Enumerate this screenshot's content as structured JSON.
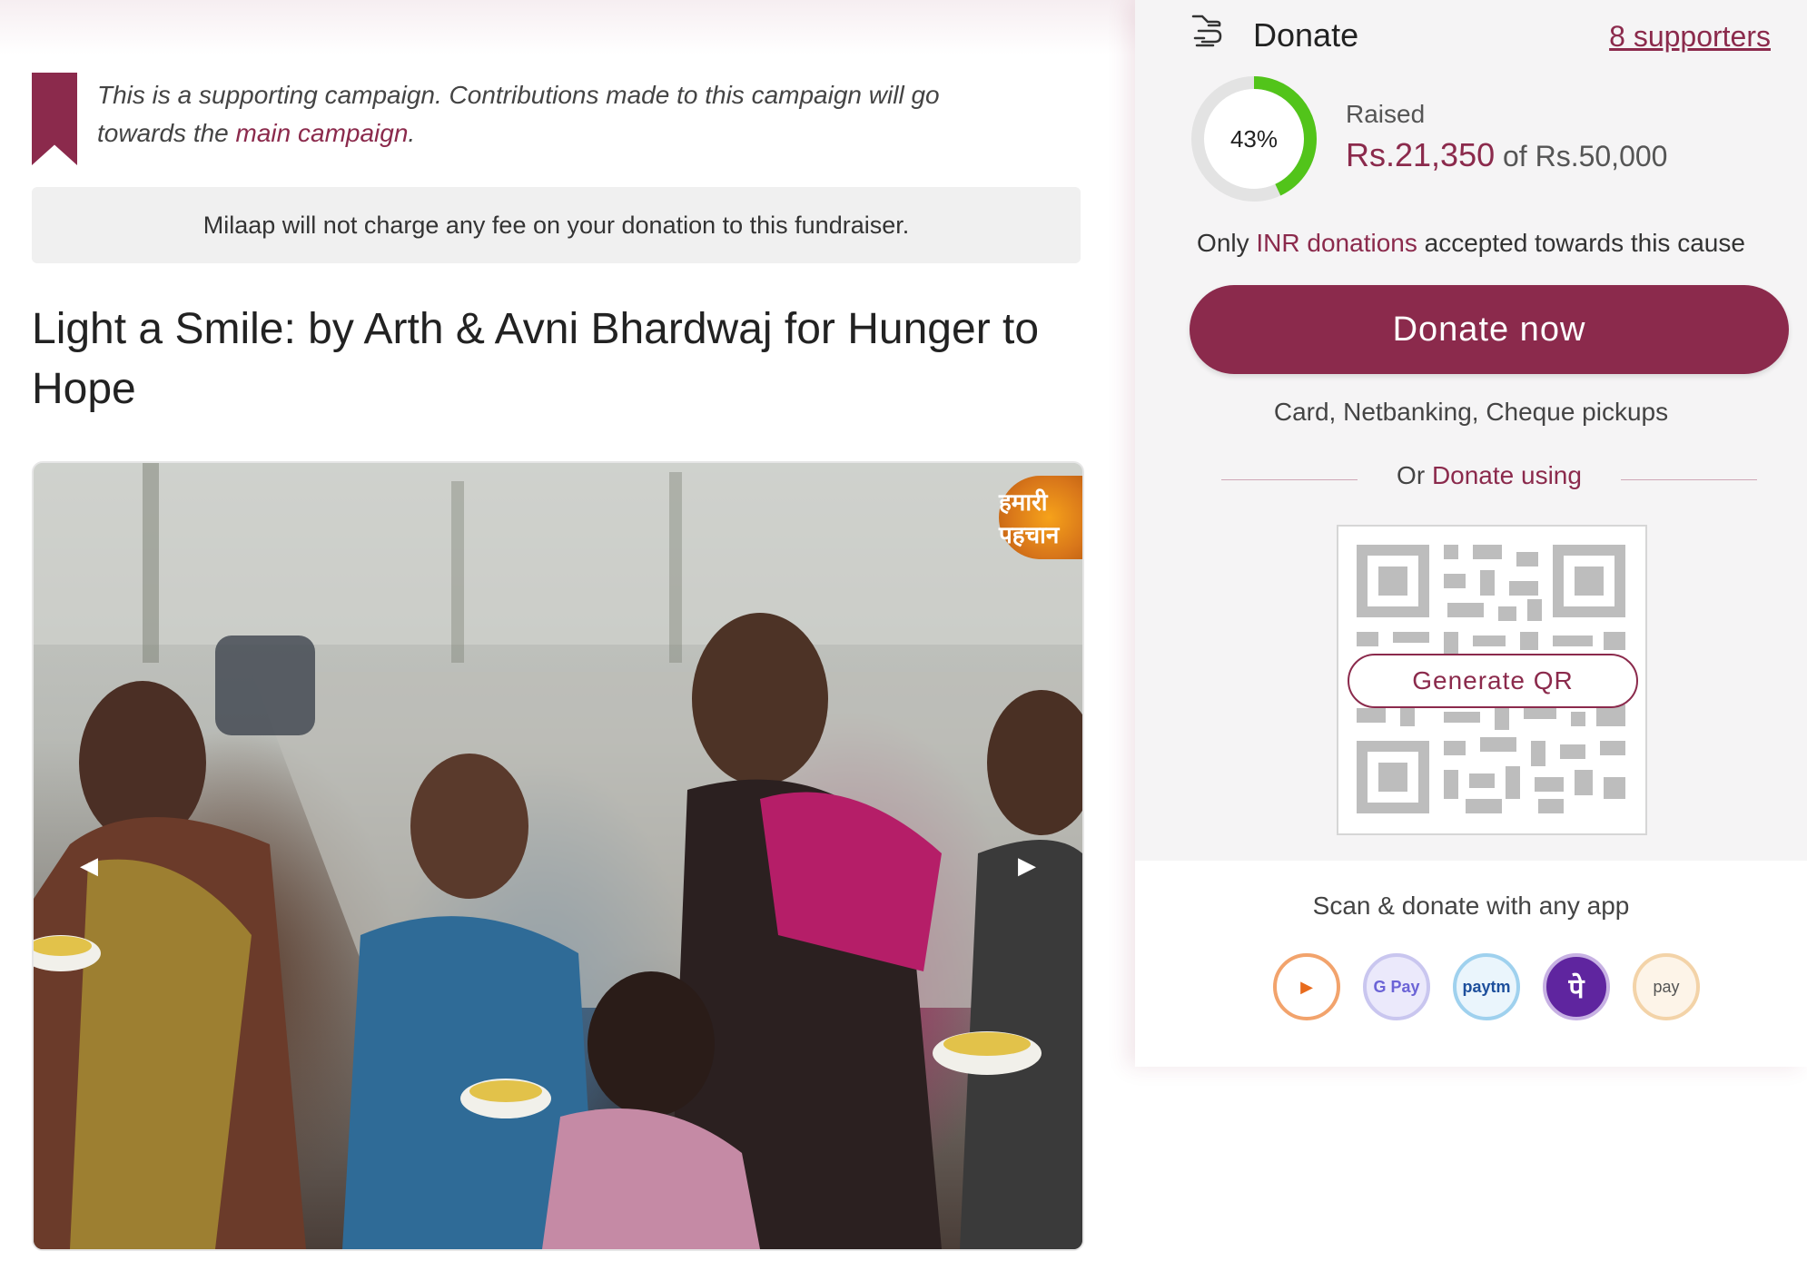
{
  "notice": {
    "text_before": "This is a supporting campaign. Contributions made to this campaign will go towards the ",
    "link": "main campaign",
    "text_after": "."
  },
  "fee_banner": "Milaap will not charge any fee on your donation to this fundraiser.",
  "campaign": {
    "title": "Light a Smile: by Arth & Avni Bhardwaj for Hunger to Hope",
    "photo_logo_text": "हमारी पहचान"
  },
  "donate": {
    "heading": "Donate",
    "supporters": "8 supporters",
    "progress_label": "43%",
    "progress_fraction": 0.43,
    "raised_label": "Raised",
    "raised_amount": "Rs.21,350",
    "of_text": "of",
    "goal_amount": "Rs.50,000",
    "inr_before": "Only ",
    "inr_accent": "INR donations",
    "inr_after": " accepted towards this cause",
    "donate_now": "Donate now",
    "methods": "Card, Netbanking, Cheque pickups",
    "or_text": "Or ",
    "or_accent": "Donate using",
    "generate_qr": "Generate QR",
    "scan_text": "Scan & donate with any app",
    "apps": [
      {
        "name": "bhim",
        "glyph": "▶"
      },
      {
        "name": "google-pay",
        "glyph": "G Pay"
      },
      {
        "name": "paytm",
        "glyph": "paytm"
      },
      {
        "name": "phonepe",
        "glyph": "पे"
      },
      {
        "name": "amazon-pay",
        "glyph": "pay"
      }
    ]
  },
  "colors": {
    "accent": "#8b2a4c",
    "progress": "#52c41a"
  }
}
